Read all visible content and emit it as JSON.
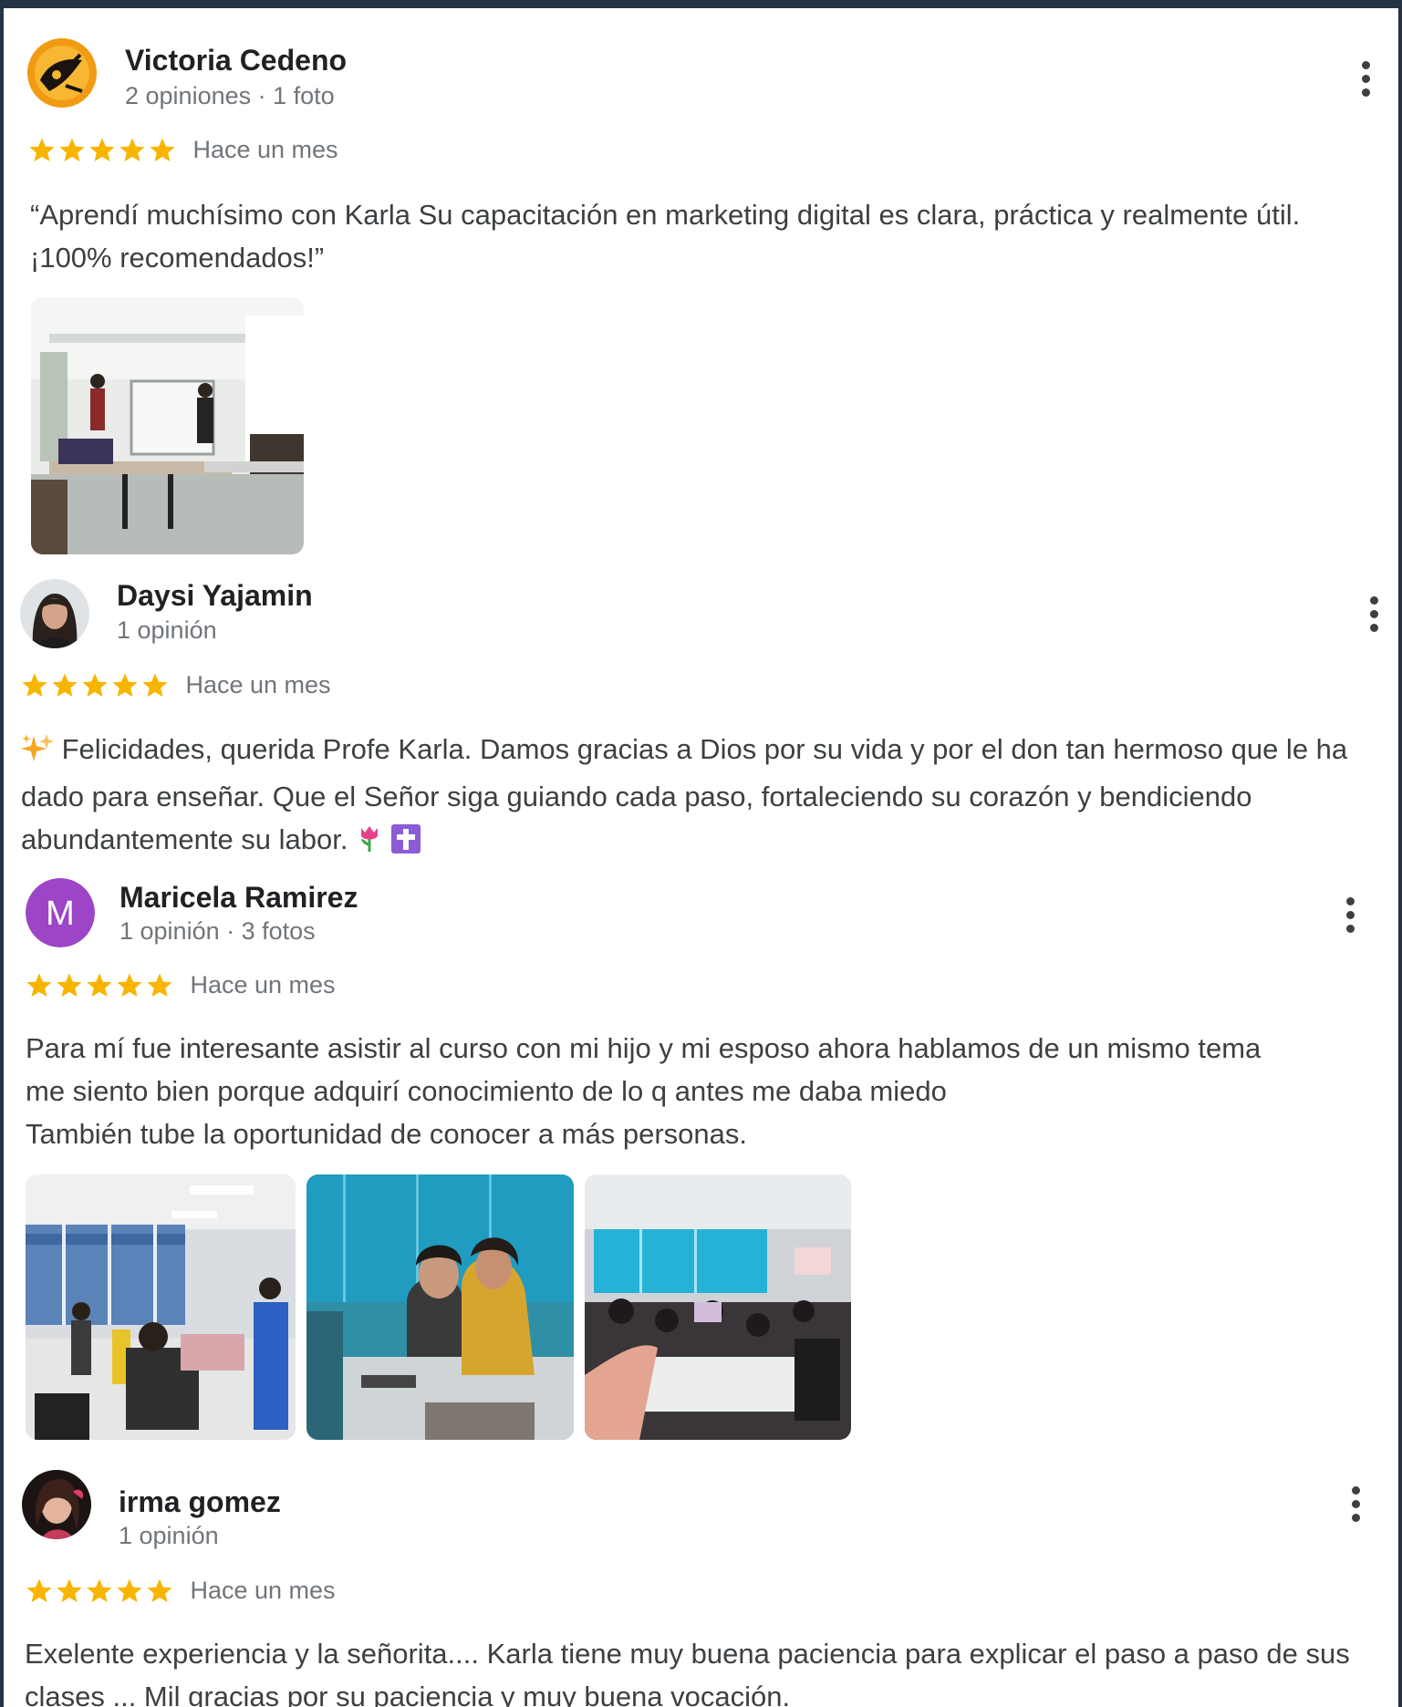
{
  "reviews": [
    {
      "name": "Victoria Cedeno",
      "meta": "2 opiniones · 1 foto",
      "rating": 5,
      "when": "Hace un mes",
      "text": "“Aprendí muchísimo con Karla Su capacitación en marketing digital es clara, práctica y realmente útil. ¡100% recomendados!”"
    },
    {
      "name": "Daysi Yajamin",
      "meta": "1 opinión",
      "rating": 5,
      "when": "Hace un mes",
      "text": "Felicidades, querida Profe Karla. Damos gracias a Dios por su vida y por el don tan hermoso que le ha dado para enseñar. Que el Señor siga guiando cada paso, fortaleciendo su corazón y bendiciendo abundantemente su labor."
    },
    {
      "name": "Maricela Ramirez",
      "meta": "1 opinión · 3 fotos",
      "avatar_letter": "M",
      "avatar_color": "#9c45c6",
      "rating": 5,
      "when": "Hace un mes",
      "text_lines": [
        "Para mí fue interesante asistir al curso con mi hijo y mi esposo ahora hablamos de un mismo tema",
        "me siento bien porque adquirí conocimiento de lo q antes me daba miedo",
        "También tube la oportunidad de conocer a más personas."
      ]
    },
    {
      "name": "irma gomez",
      "meta": "1 opinión",
      "rating": 5,
      "when": "Hace un mes",
      "text": "Exelente experiencia y la señorita.... Karla tiene muy buena paciencia para explicar el paso a paso de sus clases ... Mil gracias por su paciencia y muy buena vocación."
    }
  ],
  "colors": {
    "star": "#f7b500",
    "name": "#202124",
    "secondary": "#70757a",
    "body_text": "#3c4043"
  },
  "icons": {
    "more": "more-vert-icon",
    "star": "star-icon",
    "sparkles": "sparkles-emoji",
    "tulip": "tulip-emoji",
    "cross": "latin-cross-emoji"
  }
}
